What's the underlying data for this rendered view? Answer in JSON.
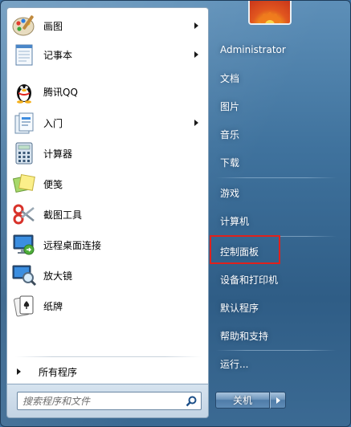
{
  "programs": [
    {
      "label": "画图",
      "has_submenu": true,
      "icon": "paint-icon"
    },
    {
      "label": "记事本",
      "has_submenu": true,
      "icon": "notepad-icon"
    },
    {
      "label": "腾讯QQ",
      "has_submenu": false,
      "icon": "qq-penguin-icon"
    },
    {
      "label": "入门",
      "has_submenu": true,
      "icon": "getting-started-icon"
    },
    {
      "label": "计算器",
      "has_submenu": false,
      "icon": "calculator-icon"
    },
    {
      "label": "便笺",
      "has_submenu": false,
      "icon": "sticky-notes-icon"
    },
    {
      "label": "截图工具",
      "has_submenu": false,
      "icon": "snipping-tool-icon"
    },
    {
      "label": "远程桌面连接",
      "has_submenu": false,
      "icon": "remote-desktop-icon"
    },
    {
      "label": "放大镜",
      "has_submenu": false,
      "icon": "magnifier-icon"
    },
    {
      "label": "纸牌",
      "has_submenu": false,
      "icon": "solitaire-icon"
    }
  ],
  "all_programs": {
    "label": "所有程序"
  },
  "search": {
    "placeholder": "搜索程序和文件"
  },
  "right_pane": {
    "user": "Administrator",
    "items": [
      {
        "label": "文档"
      },
      {
        "label": "图片"
      },
      {
        "label": "音乐"
      },
      {
        "label": "下载"
      },
      {
        "label": "游戏"
      },
      {
        "label": "计算机"
      },
      {
        "label": "控制面板",
        "highlighted": true
      },
      {
        "label": "设备和打印机"
      },
      {
        "label": "默认程序"
      },
      {
        "label": "帮助和支持"
      },
      {
        "label": "运行..."
      }
    ]
  },
  "shutdown": {
    "label": "关机"
  },
  "colors": {
    "highlight": "#e0211c",
    "frame": "#3f729d"
  }
}
